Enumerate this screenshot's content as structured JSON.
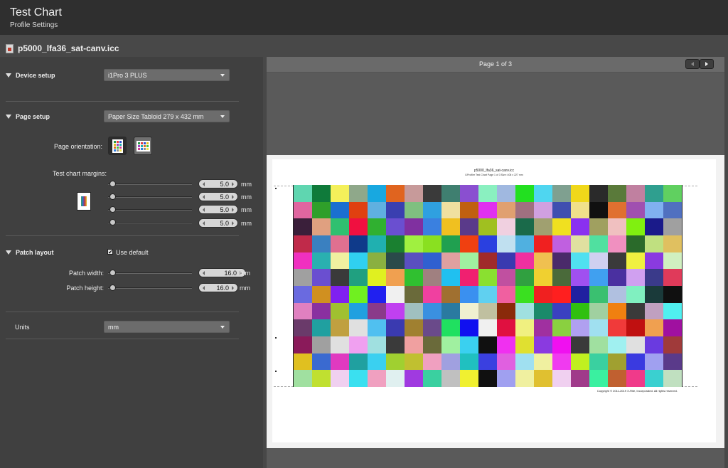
{
  "header": {
    "title": "Test Chart",
    "subtitle": "Profile Settings"
  },
  "file": {
    "icon": "profile-file-icon",
    "name": "p5000_lfa36_sat-canv.icc"
  },
  "device_setup": {
    "label": "Device setup",
    "device": "i1Pro 3 PLUS"
  },
  "page_setup": {
    "label": "Page setup",
    "paper": "Paper Size Tabloid  279 x 432 mm",
    "orientation_label": "Page orientation:",
    "margins_label": "Test chart margins:",
    "margins": [
      {
        "value": "5.0",
        "unit": "mm"
      },
      {
        "value": "5.0",
        "unit": "mm"
      },
      {
        "value": "5.0",
        "unit": "mm"
      },
      {
        "value": "5.0",
        "unit": "mm"
      }
    ]
  },
  "patch_layout": {
    "label": "Patch layout",
    "use_default_label": "Use default",
    "use_default_checked": true,
    "checkmark": "✔",
    "width_label": "Patch width:",
    "width_value": "16.0",
    "width_unit": "mm",
    "height_label": "Patch height:",
    "height_value": "16.0",
    "height_unit": "mm"
  },
  "units": {
    "label": "Units",
    "value": "mm"
  },
  "preview": {
    "page_label": "Page 1 of 3",
    "chart_title": "p5000_lfa36_sat-canv.icc",
    "chart_subtitle": "i1Profiler Test Chart Page 1 of 3 Size: 406 x 227 mm",
    "copyright": "Copyright © 2011-2019 X-Rite, Incorporated. All rights reserved."
  },
  "colors": {
    "patches": [
      "#5fd6b0",
      "#0f7a3a",
      "#f4f05a",
      "#8fa88a",
      "#18a8e0",
      "#e0641f",
      "#c79a9a",
      "#3a3a3a",
      "#3f7f70",
      "#8a4fd0",
      "#8af0c0",
      "#a0b8e0",
      "#22e020",
      "#4fd6f0",
      "#7fa090",
      "#f0d81a",
      "#2a2a2a",
      "#5a7a3a",
      "#c080a0",
      "#2f9f8f",
      "#60d060",
      "#e066a0",
      "#2f9f2a",
      "#1a6fd0",
      "#e04010",
      "#5fb0e0",
      "#3a3fb0",
      "#7fc080",
      "#2fa0e0",
      "#f0e0a0",
      "#c06010",
      "#e030f0",
      "#e0a070",
      "#a07080",
      "#d0a0e0",
      "#3f4fb0",
      "#f0e08a",
      "#101010",
      "#e07030",
      "#a050b0",
      "#80b0f0",
      "#5070c0",
      "#3a1f3a",
      "#e0a080",
      "#30c070",
      "#f01040",
      "#30b030",
      "#6a4fd0",
      "#8030a0",
      "#3a80e0",
      "#f0c020",
      "#5a3a8a",
      "#a0c020",
      "#f0d0e0",
      "#1a6a4a",
      "#a0a070",
      "#f0e020",
      "#8a30f0",
      "#a0a060",
      "#f0c0c0",
      "#80f010",
      "#1a1a8a",
      "#a0a0a0",
      "#c02a4a",
      "#3a80c0",
      "#e07090",
      "#0f3a8a",
      "#20b0b0",
      "#1a8030",
      "#a0f040",
      "#8ae020",
      "#20a050",
      "#f04010",
      "#2a40e0",
      "#c0e0f0",
      "#50b0e0",
      "#f02020",
      "#c060e0",
      "#e0e0a0",
      "#50e0a0",
      "#f090c0",
      "#2a6a2a",
      "#c0e080",
      "#e0c060",
      "#f030c0",
      "#2ab0b0",
      "#f0f0a0",
      "#30d0f0",
      "#8ab040",
      "#2a4a4a",
      "#5a4fc0",
      "#3060d0",
      "#e0a0a0",
      "#a0f0a0",
      "#a02a2a",
      "#3a3ab0",
      "#f030a0",
      "#f0c050",
      "#4a2a6a",
      "#50e0f0",
      "#d0d0f0",
      "#3a3a3a",
      "#f0f040",
      "#8a3ae0",
      "#d0f0c0",
      "#a0a0a0",
      "#6a4fd0",
      "#3a3a3a",
      "#20a080",
      "#e0f020",
      "#f0a050",
      "#30c030",
      "#a08080",
      "#20c0f0",
      "#f02070",
      "#8ae030",
      "#c050a0",
      "#30a040",
      "#f0d030",
      "#4a6a3a",
      "#a050f0",
      "#40a0f0",
      "#4a30a0",
      "#d0a0f0",
      "#3a3a8a",
      "#e03a5a",
      "#6a6ae0",
      "#d09020",
      "#8020f0",
      "#70f020",
      "#2020f0",
      "#f0f0f0",
      "#6a6a3a",
      "#f040a0",
      "#a07030",
      "#3a90f0",
      "#60d0f0",
      "#f060a0",
      "#3ae020",
      "#f02020",
      "#ff1f1f",
      "#2020a0",
      "#3ac070",
      "#b0c0e0",
      "#80f0c0",
      "#1a3a3a",
      "#101010",
      "#e080c0",
      "#8a30a0",
      "#a0c030",
      "#20a0e0",
      "#8a3a8a",
      "#c040f0",
      "#a0c0c0",
      "#3a90e0",
      "#2a7aa0",
      "#f0f0d0",
      "#c0c0a0",
      "#8a2a0a",
      "#a0e0e0",
      "#1a8a6a",
      "#3a40c0",
      "#30c010",
      "#a0d0a0",
      "#f08010",
      "#3a3a3a",
      "#c0a0c0",
      "#50f0f0",
      "#6a3a6a",
      "#20a0a0",
      "#c0a040",
      "#e0e0e0",
      "#50c0f0",
      "#3a3ab0",
      "#a08030",
      "#6a4a8a",
      "#20e060",
      "#1010f0",
      "#f0f0f0",
      "#e01040",
      "#f0f080",
      "#a030a0",
      "#8ad040",
      "#b0a0f0",
      "#a0e0f0",
      "#f03a3a",
      "#c01010",
      "#f0a050",
      "#a010a0",
      "#8a1a5a",
      "#a0a0a0",
      "#e0e0e0",
      "#f0a0f0",
      "#a0e0e0",
      "#3a3a3a",
      "#f0a0a0",
      "#6a6a3a",
      "#a0f0a0",
      "#3ad0f0",
      "#101010",
      "#f030f0",
      "#e0e030",
      "#8a3ae0",
      "#f010f0",
      "#3a3a3a",
      "#a0e0a0",
      "#a0f0f0",
      "#e0e0e0",
      "#6a3ae0",
      "#a03a3a",
      "#e0c020",
      "#3a6ad0",
      "#e03ac0",
      "#20a0a0",
      "#3ad0f0",
      "#a0d030",
      "#c0c030",
      "#f0a0c0",
      "#a0a0e0",
      "#20c0c0",
      "#3a40e0",
      "#e060e0",
      "#a0e0f0",
      "#f0f0a0",
      "#f03af0",
      "#c0f020",
      "#3ad0a0",
      "#a0a030",
      "#3a3ae0",
      "#a0a0f0",
      "#5a3a8a",
      "#a0e0a0",
      "#c0e030",
      "#f0d0f0",
      "#3ae0f0",
      "#f0a0c0",
      "#e0f0f0",
      "#a03ae0",
      "#3ad0a0",
      "#c0c0c0",
      "#f0f030",
      "#101010",
      "#a0a0f0",
      "#f0f0a0",
      "#e0c030",
      "#f0d0f0",
      "#a03a8a",
      "#3af0a0",
      "#c06030",
      "#f03a8a",
      "#3ad0d0",
      "#c0e0c0"
    ]
  }
}
